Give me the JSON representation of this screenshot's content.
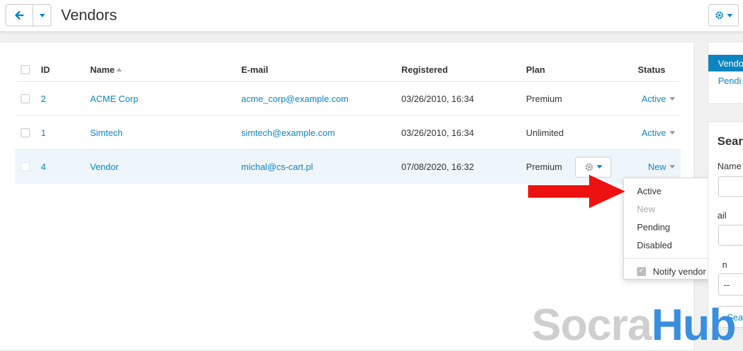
{
  "page": {
    "title": "Vendors"
  },
  "table": {
    "headers": {
      "id": "ID",
      "name": "Name",
      "email": "E-mail",
      "registered": "Registered",
      "plan": "Plan",
      "status": "Status"
    },
    "rows": [
      {
        "id": "2",
        "name": "ACME Corp",
        "email": "acme_corp@example.com",
        "registered": "03/26/2010, 16:34",
        "plan": "Premium",
        "status": "Active"
      },
      {
        "id": "1",
        "name": "Simtech",
        "email": "simtech@example.com",
        "registered": "03/26/2010, 16:34",
        "plan": "Unlimited",
        "status": "Active"
      },
      {
        "id": "4",
        "name": "Vendor",
        "email": "michal@cs-cart.pl",
        "registered": "07/08/2020, 16:32",
        "plan": "Premium",
        "status": "New"
      }
    ]
  },
  "status_menu": {
    "items": [
      "Active",
      "New",
      "Pending",
      "Disabled"
    ],
    "disabled_item": "New",
    "notify_label": "Notify vendor",
    "notify_checked": true
  },
  "sidebar": {
    "tab_active": "Vendo",
    "tab_link": "Pendi",
    "search_title": "Searc",
    "name_label": "Name",
    "field2_fragment": "ail",
    "field3_fragment": "n",
    "select_value": "--",
    "search_button": "Sea"
  },
  "watermark": {
    "part1": "Socra",
    "part2": "Hub"
  },
  "colors": {
    "accent": "#0b85c2",
    "arrow": "#ee1111",
    "row_highlight": "#eef6fb"
  }
}
